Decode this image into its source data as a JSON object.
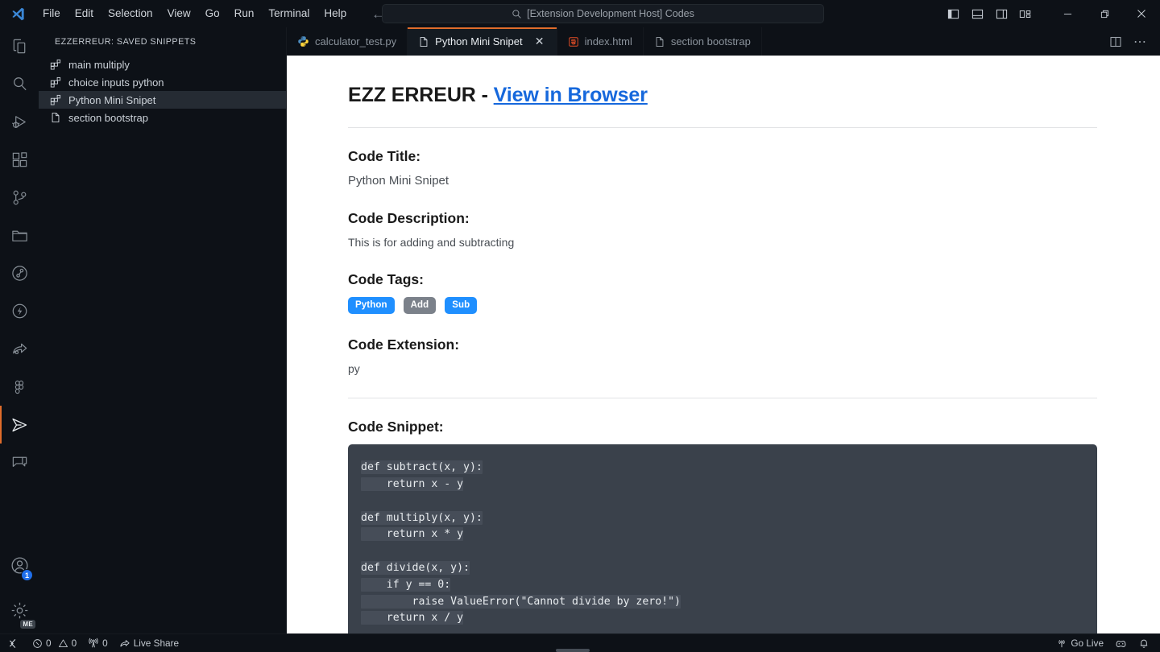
{
  "titlebar": {
    "logo_icon": "vscode-logo-icon",
    "menu": [
      {
        "label": "File"
      },
      {
        "label": "Edit"
      },
      {
        "label": "Selection"
      },
      {
        "label": "View"
      },
      {
        "label": "Go"
      },
      {
        "label": "Run"
      },
      {
        "label": "Terminal"
      },
      {
        "label": "Help"
      }
    ],
    "nav": {
      "back_icon": "arrow-left-icon",
      "forward_icon": "arrow-right-icon"
    },
    "search": {
      "icon": "search-icon",
      "value": "[Extension Development Host] Codes"
    },
    "layout_buttons": [
      {
        "name": "toggle-primary-sidebar-icon"
      },
      {
        "name": "toggle-panel-icon"
      },
      {
        "name": "toggle-secondary-sidebar-icon"
      },
      {
        "name": "customize-layout-icon"
      }
    ],
    "window_controls": [
      {
        "name": "minimize-button",
        "glyph": "—"
      },
      {
        "name": "restore-button",
        "glyph": "❐"
      },
      {
        "name": "close-button",
        "glyph": "✕"
      }
    ]
  },
  "activitybar": {
    "items": [
      {
        "name": "explorer",
        "icon": "files-icon",
        "active": false
      },
      {
        "name": "search",
        "icon": "search-icon",
        "active": false
      },
      {
        "name": "run-and-debug",
        "icon": "debug-icon",
        "active": false
      },
      {
        "name": "extensions",
        "icon": "extensions-icon",
        "active": false
      },
      {
        "name": "source-control",
        "icon": "source-control-icon",
        "active": false
      },
      {
        "name": "explorer-folder",
        "icon": "folder-icon",
        "active": false
      },
      {
        "name": "git-graph",
        "icon": "git-graph-icon",
        "active": false
      },
      {
        "name": "thunder-client",
        "icon": "thunder-icon",
        "active": false
      },
      {
        "name": "share",
        "icon": "share-icon",
        "active": false
      },
      {
        "name": "figma",
        "icon": "figma-icon",
        "active": false
      },
      {
        "name": "ezzerreur-snippets",
        "icon": "send-plane-icon",
        "active": true
      },
      {
        "name": "comments",
        "icon": "comment-icon",
        "active": false
      }
    ],
    "bottom": {
      "account": {
        "icon": "account-icon",
        "badge": "1"
      },
      "settings": {
        "icon": "gear-icon",
        "badge": "ME"
      }
    }
  },
  "sidebar": {
    "title": "EZZERREUR: SAVED SNIPPETS",
    "items": [
      {
        "label": "main multiply",
        "icon": "snippet-icon",
        "selected": false
      },
      {
        "label": "choice inputs python",
        "icon": "snippet-icon",
        "selected": false
      },
      {
        "label": "Python Mini Snipet",
        "icon": "snippet-icon",
        "selected": true
      },
      {
        "label": "section bootstrap",
        "icon": "file-icon",
        "selected": false
      }
    ]
  },
  "tabs": [
    {
      "label": "calculator_test.py",
      "icon": "python-file-icon",
      "active": false,
      "closable": false
    },
    {
      "label": "Python Mini Snipet",
      "icon": "generic-file-icon",
      "active": true,
      "closable": true,
      "close_glyph": "✕"
    },
    {
      "label": "index.html",
      "icon": "html5-file-icon",
      "active": false,
      "closable": false
    },
    {
      "label": "section bootstrap",
      "icon": "generic-file-icon",
      "active": false,
      "closable": false
    }
  ],
  "editor_actions": [
    {
      "name": "split-editor-right-icon"
    },
    {
      "name": "more-actions-icon",
      "glyph": "⋯"
    }
  ],
  "webview": {
    "title_prefix": "EZZ ERREUR - ",
    "title_link": "View in Browser",
    "sections": {
      "code_title_heading": "Code Title:",
      "code_title_value": "Python Mini Snipet",
      "code_description_heading": "Code Description:",
      "code_description_value": "This is for adding and subtracting",
      "code_tags_heading": "Code Tags:",
      "code_extension_heading": "Code Extension:",
      "code_extension_value": "py",
      "code_snippet_heading": "Code Snippet:"
    },
    "tags": [
      {
        "label": "Python",
        "color": "#1f8fff"
      },
      {
        "label": "Add",
        "color": "#7b818a"
      },
      {
        "label": "Sub",
        "color": "#1f8fff"
      }
    ],
    "code_lines": [
      "def subtract(x, y):",
      "    return x - y",
      "",
      "def multiply(x, y):",
      "    return x * y",
      "",
      "def divide(x, y):",
      "    if y == 0:",
      "        raise ValueError(\"Cannot divide by zero!\")",
      "    return x / y"
    ],
    "code_background": "#3a414b"
  },
  "statusbar": {
    "remote_icon": "remote-window-icon",
    "left": [
      {
        "name": "problems",
        "icons": [
          "error-icon",
          "warning-icon"
        ],
        "error_count": "0",
        "warning_count": "0"
      },
      {
        "name": "ports",
        "icon": "radio-tower-icon",
        "count": "0"
      },
      {
        "name": "live-share",
        "icon": "live-share-icon",
        "label": "Live Share"
      }
    ],
    "right": [
      {
        "name": "go-live",
        "icon": "broadcast-icon",
        "label": "Go Live"
      },
      {
        "name": "feedback",
        "icon": "smiley-icon",
        "label": ""
      },
      {
        "name": "notifications",
        "icon": "bell-icon",
        "label": ""
      }
    ]
  }
}
